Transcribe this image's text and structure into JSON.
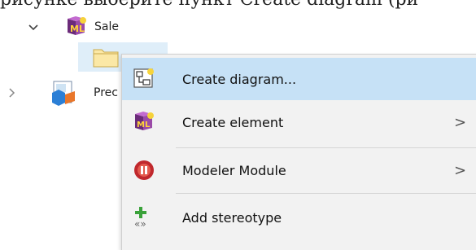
{
  "caption": "рисунке выберите пункт Create diagram (ри",
  "tree": {
    "items": [
      {
        "label": "Sale",
        "icon": "uml-package-icon",
        "expanded": true
      },
      {
        "label": "",
        "icon": "folder-icon",
        "selected": true
      },
      {
        "label": "Prec",
        "icon": "model-icon",
        "expanded": false
      }
    ]
  },
  "context_menu": {
    "items": [
      {
        "label": "Create diagram...",
        "icon": "create-diagram-icon",
        "highlighted": true,
        "submenu": false
      },
      {
        "label": "Create element",
        "icon": "create-element-icon",
        "highlighted": false,
        "submenu": true,
        "arrow": ">"
      },
      {
        "label": "Modeler Module",
        "icon": "modeler-module-icon",
        "highlighted": false,
        "submenu": true,
        "arrow": ">"
      },
      {
        "label": "Add stereotype",
        "icon": "add-stereotype-icon",
        "highlighted": false,
        "submenu": false
      }
    ]
  },
  "colors": {
    "highlight": "#c6e1f6",
    "selection": "#dfeef9",
    "menu_bg": "#f2f2f2"
  }
}
